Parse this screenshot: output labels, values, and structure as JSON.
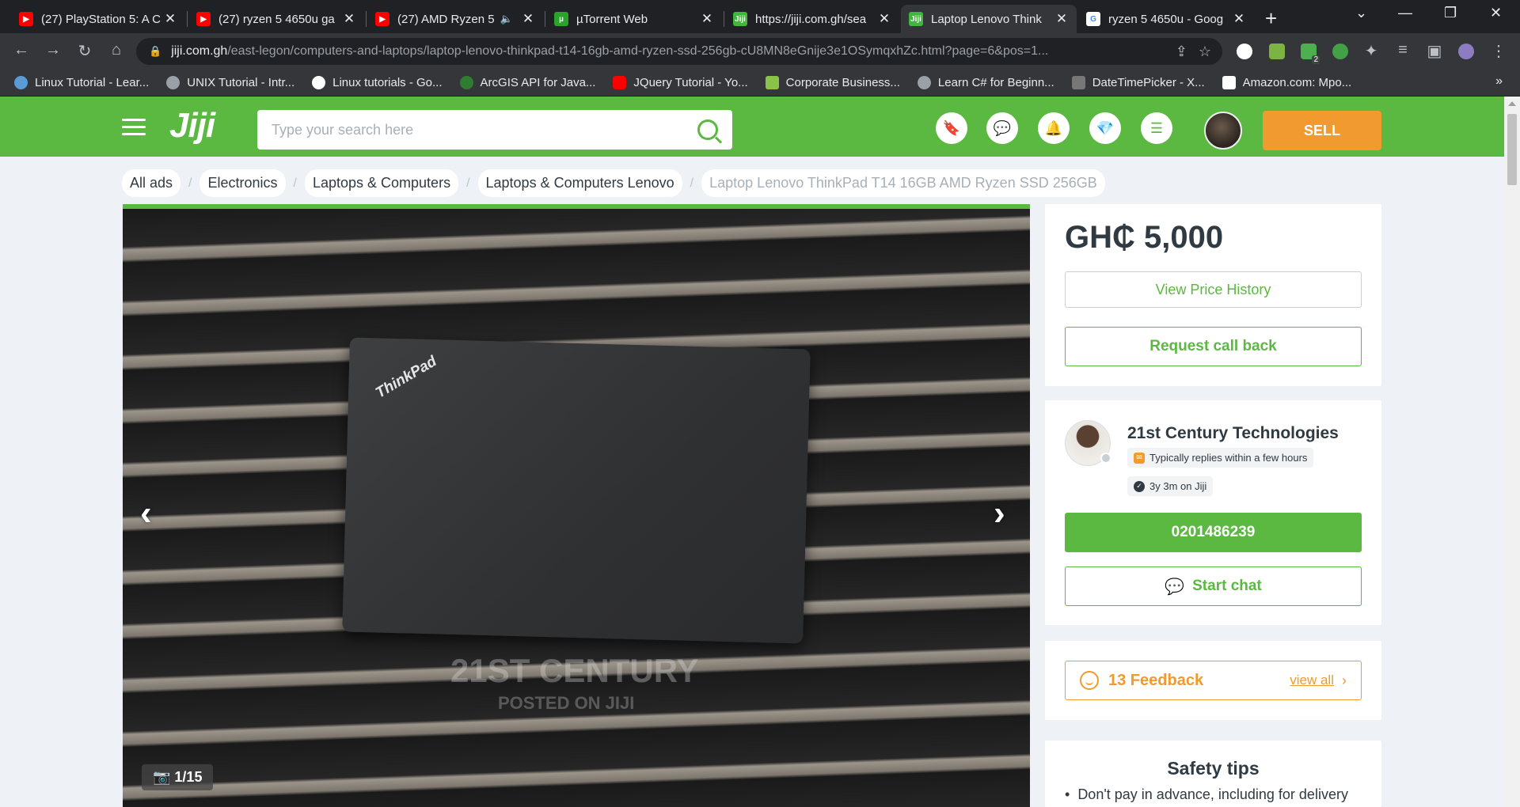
{
  "browser": {
    "tabs": [
      {
        "title": "(27) PlayStation 5: A C",
        "favicon": "youtube-icon"
      },
      {
        "title": "(27) ryzen 5 4650u ga",
        "favicon": "youtube-icon"
      },
      {
        "title": "(27) AMD Ryzen 5",
        "favicon": "youtube-icon"
      },
      {
        "title": "µTorrent Web",
        "favicon": "utorrent-icon"
      },
      {
        "title": "https://jiji.com.gh/sea",
        "favicon": "jiji-icon"
      },
      {
        "title": "Laptop Lenovo Think",
        "favicon": "jiji-icon",
        "active": true
      },
      {
        "title": "ryzen 5 4650u - Goog",
        "favicon": "google-icon"
      }
    ],
    "url_host": "jiji.com.gh",
    "url_path": "/east-legon/computers-and-laptops/laptop-lenovo-thinkpad-t14-16gb-amd-ryzen-ssd-256gb-cU8MN8eGnije3e1OSymqxhZc.html?page=6&pos=1...",
    "extension_badge": "2",
    "bookmarks": [
      {
        "label": "Linux Tutorial - Lear...",
        "color": "#5b9bd5"
      },
      {
        "label": "UNIX Tutorial - Intr...",
        "color": "#9aa0a6"
      },
      {
        "label": "Linux tutorials - Go...",
        "color": "#ffffff"
      },
      {
        "label": "ArcGIS API for Java...",
        "color": "#2e7d32"
      },
      {
        "label": "JQuery Tutorial - Yo...",
        "color": "#ff0000"
      },
      {
        "label": "Corporate Business...",
        "color": "#8bc34a"
      },
      {
        "label": "Learn C# for Beginn...",
        "color": "#9aa0a6"
      },
      {
        "label": "DateTimePicker - X...",
        "color": "#777777"
      },
      {
        "label": "Amazon.com: Mpo...",
        "color": "#ffffff"
      }
    ],
    "bookmarks_more": "»"
  },
  "header": {
    "logo": "Jiji",
    "search_placeholder": "Type your search here",
    "icons": [
      "bookmark-icon",
      "chat-icon",
      "bell-icon",
      "diamond-icon",
      "list-icon"
    ],
    "sell_label": "SELL"
  },
  "breadcrumbs": [
    "All ads",
    "Electronics",
    "Laptops & Computers",
    "Laptops & Computers Lenovo",
    "Laptop Lenovo ThinkPad T14 16GB AMD Ryzen SSD 256GB"
  ],
  "gallery": {
    "brand_text": "ThinkPad",
    "watermark_line1": "21ST CENTURY",
    "watermark_line2": "POSTED ON JIJI",
    "counter": "1/15"
  },
  "listing": {
    "price": "GH₵ 5,000",
    "view_price_history": "View Price History",
    "request_call_back": "Request call back"
  },
  "seller": {
    "name": "21st Century Technologies",
    "replies": "Typically replies within a few hours",
    "tenure": "3y 3m on Jiji",
    "phone": "0201486239",
    "start_chat": "Start chat"
  },
  "feedback": {
    "label": "13 Feedback",
    "view_all": "view all"
  },
  "safety": {
    "title": "Safety tips",
    "tips": [
      "Don't pay in advance, including for delivery"
    ]
  },
  "colors": {
    "brand_green": "#5bb840",
    "sell_orange": "#f09a30"
  }
}
